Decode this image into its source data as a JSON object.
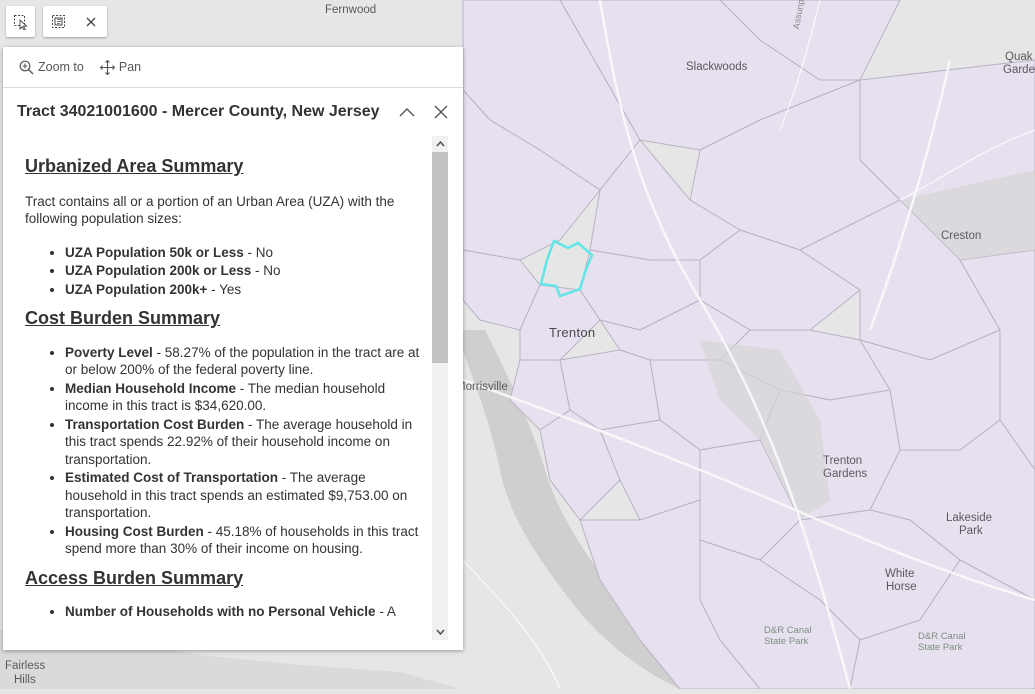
{
  "map": {
    "labels": {
      "fernwood": "Fernwood",
      "slackwoods": "Slackwoods",
      "quaker1": "Quak",
      "quaker2": "Garde",
      "assunpink": "Assunpink Creek",
      "creston": "Creston",
      "trenton": "Trenton",
      "morrisville": "Morrisville",
      "trenton_gardens1": "Trenton",
      "trenton_gardens2": "Gardens",
      "lakeside1": "Lakeside",
      "lakeside2": "Park",
      "white_horse1": "White",
      "white_horse2": "Horse",
      "dr_canal_1a": "D&R Canal",
      "dr_canal_1b": "State Park",
      "dr_canal_2a": "D&R Canal",
      "dr_canal_2b": "State Park",
      "fairless1": "Fairless",
      "fairless2": "Hills"
    },
    "colors": {
      "base": "#e6e6e6",
      "tract_fill": "#e6e0ef",
      "tract_stroke": "#b9b2c4",
      "highlight": "#5ee6e8",
      "water": "#c8c8c8"
    }
  },
  "toolbar": {
    "select_tool": "select-cursor",
    "select_box": "select-box",
    "clear": "close"
  },
  "popup": {
    "actions": {
      "zoom_to": "Zoom to",
      "pan": "Pan"
    },
    "title": "Tract 34021001600 - Mercer County, New Jersey",
    "sections": {
      "uza": {
        "heading": "Urbanized Area Summary",
        "intro": "Tract contains all or a portion of an Urban Area (UZA) with the following population sizes:",
        "items": [
          {
            "label": "UZA Population 50k or Less",
            "text": " - No"
          },
          {
            "label": "UZA Population 200k or Less",
            "text": " - No"
          },
          {
            "label": "UZA Population 200k+",
            "text": " - Yes"
          }
        ]
      },
      "cost": {
        "heading": "Cost Burden Summary",
        "items": [
          {
            "label": "Poverty Level",
            "text": " - 58.27% of the population in the tract are at or below 200% of the federal poverty line."
          },
          {
            "label": "Median Household Income",
            "text": " - The median household income in this tract is $34,620.00."
          },
          {
            "label": "Transportation Cost Burden",
            "text": " - The average household in this tract spends 22.92% of their household income on transportation."
          },
          {
            "label": "Estimated Cost of Transportation",
            "text": " - The average household in this tract spends an estimated $9,753.00  on transportation."
          },
          {
            "label": "Housing Cost Burden",
            "text": " - 45.18% of households in this tract spend more than 30% of their income on housing."
          }
        ]
      },
      "access": {
        "heading": "Access Burden Summary",
        "items": [
          {
            "label": "Number of Households with no Personal Vehicle",
            "text": " - A"
          }
        ]
      }
    }
  }
}
